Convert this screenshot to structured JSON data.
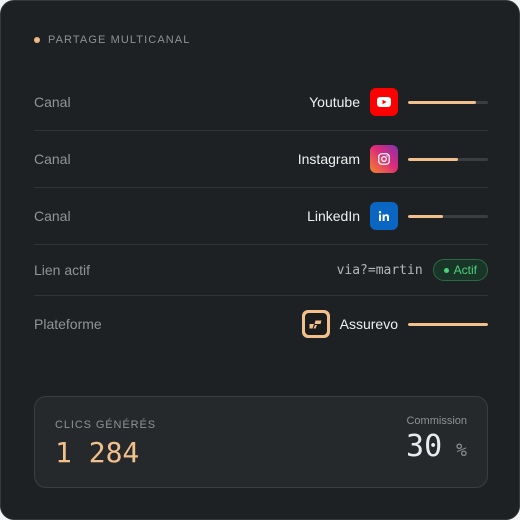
{
  "header": {
    "title": "PARTAGE MULTICANAL",
    "accent": "#f2b880"
  },
  "channels": [
    {
      "label": "Canal",
      "name": "Youtube",
      "icon": "youtube-icon",
      "color": "#ff0000",
      "progress": 0.85
    },
    {
      "label": "Canal",
      "name": "Instagram",
      "icon": "instagram-icon",
      "color": "#e1306c",
      "progress": 0.63
    },
    {
      "label": "Canal",
      "name": "LinkedIn",
      "icon": "linkedin-icon",
      "color": "#0a66c2",
      "progress": 0.44
    }
  ],
  "link": {
    "label": "Lien actif",
    "value": "via?=martin",
    "status": "Actif",
    "status_color": "#4fd07d"
  },
  "platform": {
    "label": "Plateforme",
    "name": "Assurevo",
    "icon": "assurevo-logo-icon",
    "progress": 1.0
  },
  "stats": {
    "clicks_label": "CLICS GÉNÉRÉS",
    "clicks_value": "1 284",
    "commission_label": "Commission",
    "commission_value": "30",
    "commission_unit": "%"
  }
}
